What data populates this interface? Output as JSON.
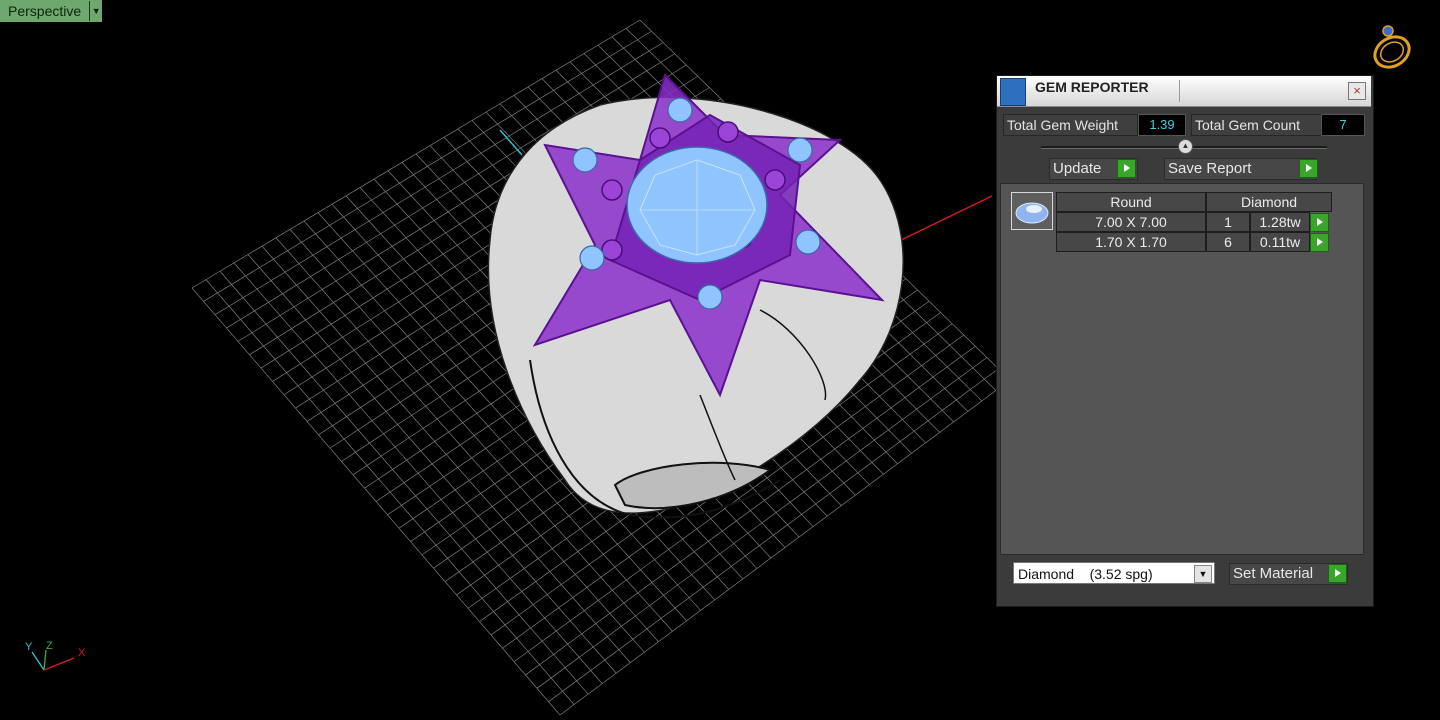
{
  "viewport": {
    "label": "Perspective",
    "dropdown_icon": "chevron-down-icon",
    "axis_labels": {
      "y": "Y",
      "z": "Z",
      "x": "X"
    },
    "grid_color": "#8a8a8a",
    "ring_color": "#e8e8e8",
    "setting_color": "#8a2fc9",
    "gem_color": "#8fc4ff"
  },
  "gem_reporter": {
    "title": "GEM REPORTER",
    "total_weight_label": "Total Gem Weight",
    "total_weight_value": "1.39",
    "total_count_label": "Total Gem Count",
    "total_count_value": "7",
    "update_label": "Update",
    "save_report_label": "Save Report",
    "table": {
      "headers": [
        "Round",
        "Diamond"
      ],
      "rows": [
        {
          "size": "7.00 X 7.00",
          "count": "1",
          "weight": "1.28tw"
        },
        {
          "size": "1.70 X 1.70",
          "count": "6",
          "weight": "0.11tw"
        }
      ]
    },
    "material_select": "Diamond    (3.52 spg)",
    "set_material_label": "Set Material",
    "accent_green": "#3aa52b",
    "value_color": "#3fd0e6"
  }
}
